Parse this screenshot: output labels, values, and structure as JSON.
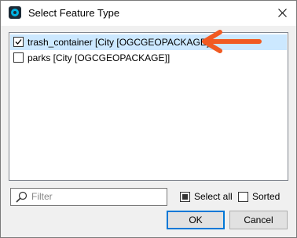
{
  "window": {
    "title": "Select Feature Type",
    "icon": "app-logo-icon",
    "close_icon": "close-icon"
  },
  "list": {
    "items": [
      {
        "label": "trash_container [City [OGCGEOPACKAGE]]",
        "checked": true,
        "selected": true
      },
      {
        "label": "parks [City [OGCGEOPACKAGE]]",
        "checked": false,
        "selected": false
      }
    ]
  },
  "annotation": {
    "arrow_color": "#f15a22"
  },
  "filter": {
    "placeholder": "Filter",
    "value": ""
  },
  "options": {
    "select_all_label": "Select all",
    "select_all_state": "partial",
    "sorted_label": "Sorted",
    "sorted_checked": false
  },
  "buttons": {
    "ok_label": "OK",
    "cancel_label": "Cancel"
  },
  "colors": {
    "selection": "#cce8ff",
    "default_button_border": "#0078d7"
  }
}
